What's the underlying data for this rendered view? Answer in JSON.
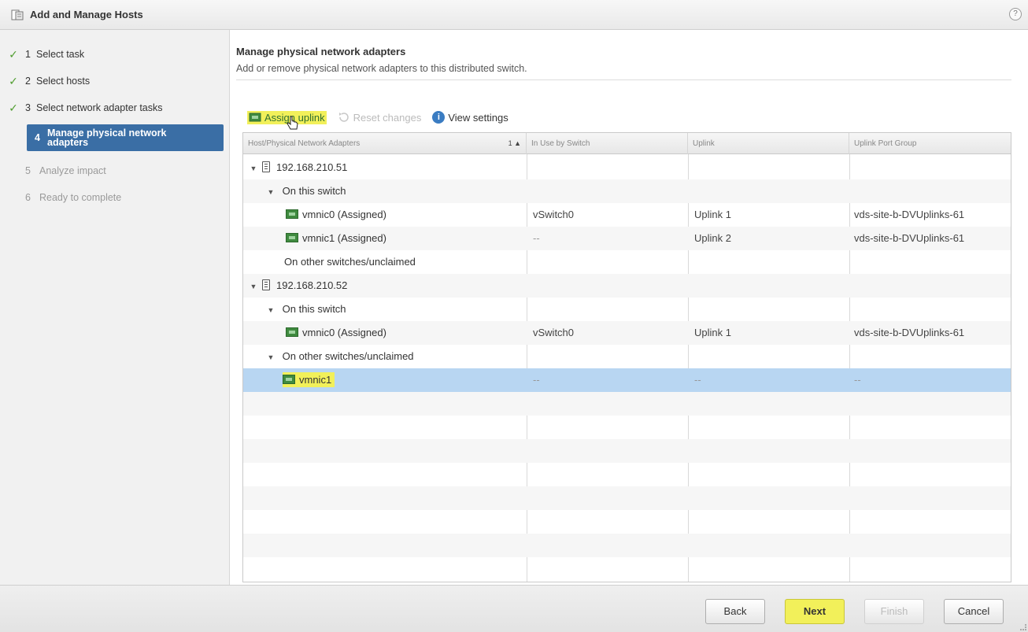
{
  "window": {
    "title": "Add and Manage Hosts",
    "help": "?"
  },
  "steps": [
    {
      "num": "1",
      "label": "Select task",
      "state": "done"
    },
    {
      "num": "2",
      "label": "Select hosts",
      "state": "done"
    },
    {
      "num": "3",
      "label": "Select network adapter tasks",
      "state": "done"
    },
    {
      "num": "4",
      "label": "Manage physical network adapters",
      "state": "active"
    },
    {
      "num": "5",
      "label": "Analyze impact",
      "state": "pending"
    },
    {
      "num": "6",
      "label": "Ready to complete",
      "state": "pending"
    }
  ],
  "page": {
    "title": "Manage physical network adapters",
    "description": "Add or remove physical network adapters to this distributed switch."
  },
  "toolbar": {
    "assign_uplink": "Assign uplink",
    "reset_changes": "Reset changes",
    "view_settings": "View settings"
  },
  "table": {
    "columns": [
      "Host/Physical Network Adapters",
      "In Use by Switch",
      "Uplink",
      "Uplink Port Group"
    ],
    "sort_indicator": "1 ▲",
    "rows": [
      {
        "label": "192.168.210.51",
        "switch": "",
        "uplink": "",
        "port_group": ""
      },
      {
        "label": "On this switch",
        "switch": "",
        "uplink": "",
        "port_group": ""
      },
      {
        "label": "vmnic0 (Assigned)",
        "switch": "vSwitch0",
        "uplink": "Uplink 1",
        "port_group": "vds-site-b-DVUplinks-61"
      },
      {
        "label": "vmnic1 (Assigned)",
        "switch": "--",
        "uplink": "Uplink 2",
        "port_group": "vds-site-b-DVUplinks-61"
      },
      {
        "label": "On other switches/unclaimed",
        "switch": "",
        "uplink": "",
        "port_group": ""
      },
      {
        "label": "192.168.210.52",
        "switch": "",
        "uplink": "",
        "port_group": ""
      },
      {
        "label": "On this switch",
        "switch": "",
        "uplink": "",
        "port_group": ""
      },
      {
        "label": "vmnic0 (Assigned)",
        "switch": "vSwitch0",
        "uplink": "Uplink 1",
        "port_group": "vds-site-b-DVUplinks-61"
      },
      {
        "label": "On other switches/unclaimed",
        "switch": "",
        "uplink": "",
        "port_group": ""
      },
      {
        "label": "vmnic1",
        "switch": "--",
        "uplink": "--",
        "port_group": "--"
      }
    ]
  },
  "buttons": {
    "back": "Back",
    "next": "Next",
    "finish": "Finish",
    "cancel": "Cancel"
  },
  "colors": {
    "active_step": "#3a6ea5",
    "highlight": "#f2f05a",
    "selected_row": "#b8d6f2"
  }
}
